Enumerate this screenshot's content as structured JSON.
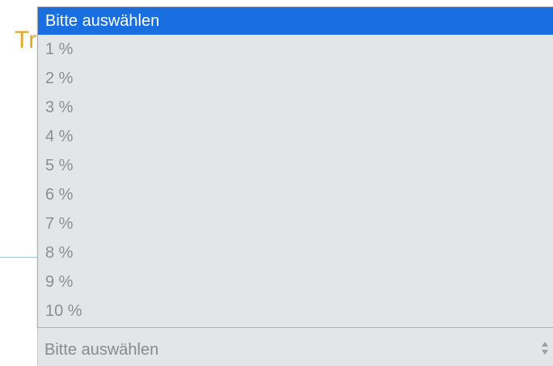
{
  "background": {
    "heading_visible_text": "Tr"
  },
  "dropdown": {
    "options": [
      "Bitte auswählen",
      "1 %",
      "2 %",
      "3 %",
      "4 %",
      "5 %",
      "6 %",
      "7 %",
      "8 %",
      "9 %",
      "10 %"
    ],
    "highlighted_option": "Bitte auswählen",
    "highlight_color": "#1a6fe0",
    "list_background": "#e2e6e9",
    "option_text_color": "#8e8e8e",
    "heading_color": "#e0a92a"
  },
  "select": {
    "value": "Bitte auswählen",
    "arrows_icon": "updown-arrows-icon"
  }
}
